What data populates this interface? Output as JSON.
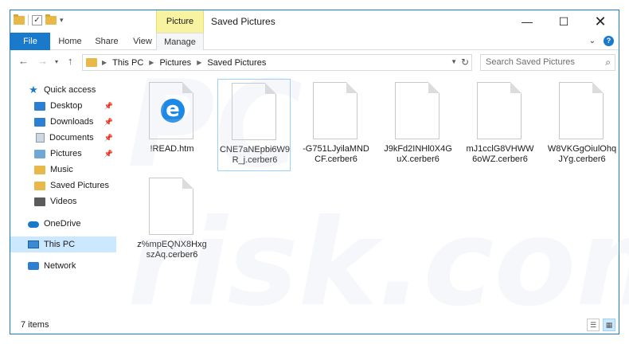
{
  "titlebar": {
    "context_tab": "Picture Tools",
    "title": "Saved Pictures",
    "controls": {
      "minimize": "—",
      "maximize": "☐",
      "close": "✕"
    }
  },
  "ribbon": {
    "tabs": [
      "File",
      "Home",
      "Share",
      "View",
      "Manage"
    ],
    "expand_glyph": "⌄",
    "help_glyph": "?"
  },
  "addressbar": {
    "crumbs": [
      "This PC",
      "Pictures",
      "Saved Pictures"
    ],
    "search_placeholder": "Search Saved Pictures"
  },
  "navpane": {
    "items": [
      {
        "label": "Quick access",
        "icon": "star-icon",
        "pinned": false
      },
      {
        "label": "Desktop",
        "icon": "folder-blue-icon",
        "pinned": true
      },
      {
        "label": "Downloads",
        "icon": "download-folder-icon",
        "pinned": true
      },
      {
        "label": "Documents",
        "icon": "documents-icon",
        "pinned": true
      },
      {
        "label": "Pictures",
        "icon": "pictures-folder-icon",
        "pinned": true
      },
      {
        "label": "Music",
        "icon": "music-folder-icon",
        "pinned": false
      },
      {
        "label": "Saved Pictures",
        "icon": "folder-icon",
        "pinned": false
      },
      {
        "label": "Videos",
        "icon": "videos-folder-icon",
        "pinned": false
      },
      {
        "label": "OneDrive",
        "icon": "onedrive-icon",
        "pinned": false
      },
      {
        "label": "This PC",
        "icon": "this-pc-icon",
        "pinned": false,
        "selected": true
      },
      {
        "label": "Network",
        "icon": "network-icon",
        "pinned": false
      }
    ]
  },
  "files": [
    {
      "name": "!READ.htm",
      "icon": "edge-icon"
    },
    {
      "name": "CNE7aNEpbi6W9R_j.cerber6",
      "icon": "file-icon",
      "focused": true
    },
    {
      "name": "-G751LJyilaMNDCF.cerber6",
      "icon": "file-icon"
    },
    {
      "name": "J9kFd2INHl0X4GuX.cerber6",
      "icon": "file-icon"
    },
    {
      "name": "mJ1cclG8VHWW6oWZ.cerber6",
      "icon": "file-icon"
    },
    {
      "name": "W8VKGgOiulOhqJYg.cerber6",
      "icon": "file-icon"
    },
    {
      "name": "z%mpEQNX8HxgszAq.cerber6",
      "icon": "file-icon"
    }
  ],
  "file_lines": [
    [
      "!READ.htm"
    ],
    [
      "CNE7aNEpbi6W9",
      "R_j.cerber6"
    ],
    [
      "-G751LJyilaMND",
      "CF.cerber6"
    ],
    [
      "J9kFd2INHl0X4G",
      "uX.cerber6"
    ],
    [
      "mJ1cclG8VHWW",
      "6oWZ.cerber6"
    ],
    [
      "W8VKGgOiulOhq",
      "JYg.cerber6"
    ],
    [
      "z%mpEQNX8Hxg",
      "szAq.cerber6"
    ]
  ],
  "statusbar": {
    "count": "7 items"
  },
  "watermark": {
    "text": "PC risk.com"
  }
}
